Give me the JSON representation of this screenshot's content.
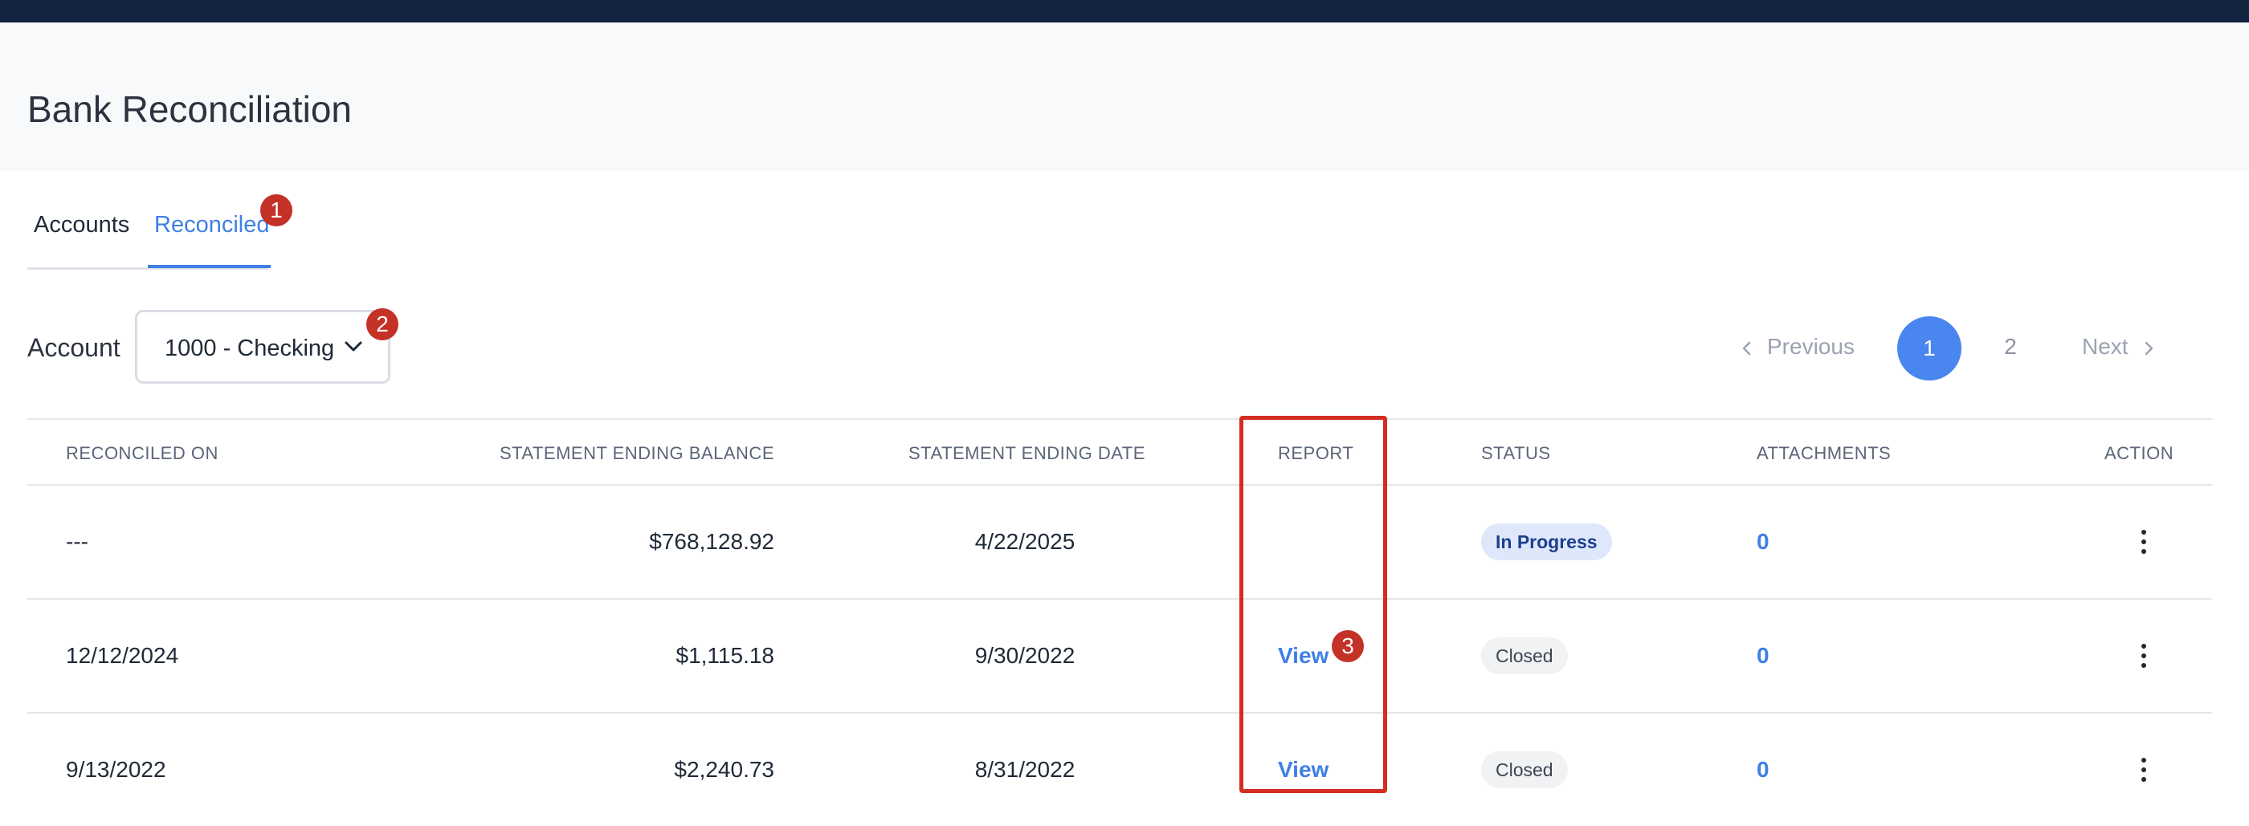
{
  "page": {
    "title": "Bank Reconciliation"
  },
  "tabs": [
    {
      "label": "Accounts",
      "active": false
    },
    {
      "label": "Reconciled",
      "active": true
    }
  ],
  "markers": [
    "1",
    "2",
    "3"
  ],
  "filter": {
    "label": "Account",
    "selected": "1000 - Checking"
  },
  "pagination": {
    "previous": "Previous",
    "pages": [
      "1",
      "2"
    ],
    "current": "1",
    "next": "Next"
  },
  "table": {
    "columns": [
      "RECONCILED ON",
      "STATEMENT ENDING BALANCE",
      "STATEMENT ENDING DATE",
      "REPORT",
      "STATUS",
      "ATTACHMENTS",
      "ACTION"
    ],
    "rows": [
      {
        "reconciled_on": "---",
        "balance": "$768,128.92",
        "ending_date": "4/22/2025",
        "report": "",
        "status": "In Progress",
        "attachments": "0"
      },
      {
        "reconciled_on": "12/12/2024",
        "balance": "$1,115.18",
        "ending_date": "9/30/2022",
        "report": "View",
        "status": "Closed",
        "attachments": "0"
      },
      {
        "reconciled_on": "9/13/2022",
        "balance": "$2,240.73",
        "ending_date": "8/31/2022",
        "report": "View",
        "status": "Closed",
        "attachments": "0"
      }
    ]
  },
  "colors": {
    "accent": "#3f7fe6",
    "topbar": "#132440",
    "marker": "#c43127",
    "highlight": "#d42d22"
  },
  "icons": {
    "account_dropdown": "chevron-down-icon",
    "previous": "chevron-left-icon",
    "next": "chevron-right-icon",
    "row_action": "more-vertical-icon"
  }
}
